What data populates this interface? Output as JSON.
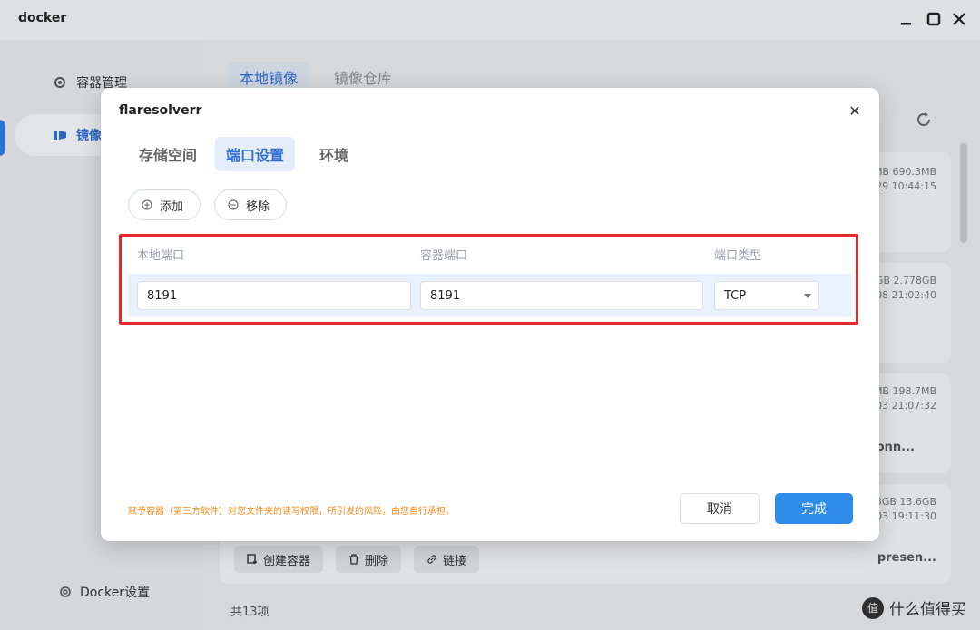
{
  "window": {
    "title": "docker"
  },
  "sidebar": {
    "items": [
      {
        "label": "容器管理",
        "icon": "gear-icon"
      },
      {
        "label": "镜像",
        "icon": "image-icon"
      }
    ],
    "footer": {
      "label": "Docker设置",
      "icon": "settings-icon"
    }
  },
  "main": {
    "tabs": [
      {
        "label": "本地镜像"
      },
      {
        "label": "镜像仓库"
      }
    ],
    "cards": [
      {
        "meta1": "MB 690.3MB",
        "meta2": "-29 10:44:15",
        "tail": ""
      },
      {
        "meta1": "GB 2.778GB",
        "meta2": "-08 21:02:40",
        "tail": ""
      },
      {
        "meta1": "MB 198.7MB",
        "meta2": "-03 21:07:32",
        "tail": "onn..."
      },
      {
        "meta1": "3GB 13.6GB",
        "meta2": "-03 19:11:30",
        "tail": "presen..."
      }
    ],
    "actions": [
      {
        "label": "创建容器",
        "icon": "create-container-icon"
      },
      {
        "label": "删除",
        "icon": "trash-icon"
      },
      {
        "label": "链接",
        "icon": "link-icon"
      }
    ],
    "count": "共13项"
  },
  "modal": {
    "title": "flaresolverr",
    "tabs": [
      {
        "label": "存储空间"
      },
      {
        "label": "端口设置"
      },
      {
        "label": "环境"
      }
    ],
    "add_label": "添加",
    "remove_label": "移除",
    "columns": {
      "local": "本地端口",
      "container": "容器端口",
      "type": "端口类型"
    },
    "row": {
      "local_port": "8191",
      "container_port": "8191",
      "type": "TCP"
    },
    "note": "赋予容器（第三方软件）对您文件夹的读写权限，所引发的风险，由您自行承担。",
    "cancel_label": "取消",
    "ok_label": "完成"
  },
  "watermark": {
    "logo": "值",
    "text": "什么值得买"
  },
  "colors": {
    "accent": "#2f8ce8",
    "highlight": "#e12a2a",
    "note": "#f28a1a"
  }
}
